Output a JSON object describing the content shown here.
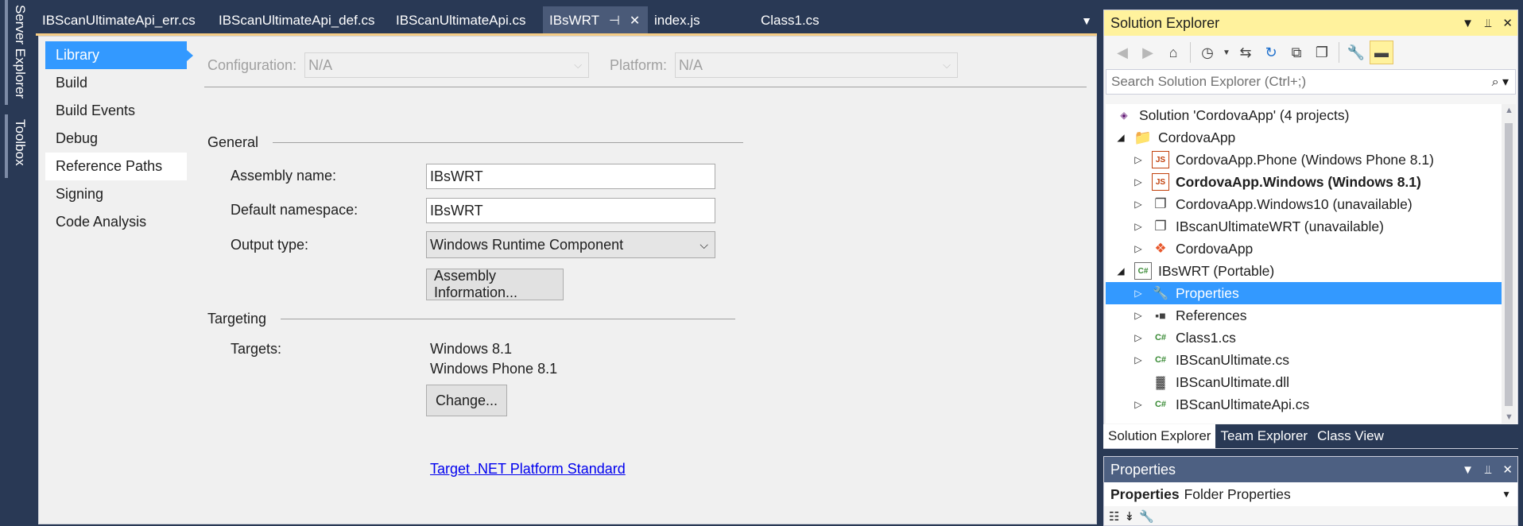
{
  "left_dock": {
    "server_explorer": "Server Explorer",
    "toolbox": "Toolbox"
  },
  "doc_tabs": [
    {
      "label": "IBScanUltimateApi_err.cs"
    },
    {
      "label": "IBScanUltimateApi_def.cs"
    },
    {
      "label": "IBScanUltimateApi.cs"
    },
    {
      "label": "IBsWRT"
    },
    {
      "label": "index.js"
    },
    {
      "label": "Class1.cs"
    }
  ],
  "prop_nav": [
    "Library",
    "Build",
    "Build Events",
    "Debug",
    "Reference Paths",
    "Signing",
    "Code Analysis"
  ],
  "config": {
    "configuration_label": "Configuration:",
    "configuration_value": "N/A",
    "platform_label": "Platform:",
    "platform_value": "N/A"
  },
  "general": {
    "header": "General",
    "assembly_name_label": "Assembly name:",
    "assembly_name_value": "IBsWRT",
    "default_namespace_label": "Default namespace:",
    "default_namespace_value": "IBsWRT",
    "output_type_label": "Output type:",
    "output_type_value": "Windows Runtime Component",
    "assembly_info_button": "Assembly Information..."
  },
  "targeting": {
    "header": "Targeting",
    "targets_label": "Targets:",
    "targets": [
      "Windows 8.1",
      "Windows Phone 8.1"
    ],
    "change_button": "Change...",
    "link": "Target .NET Platform Standard"
  },
  "solution_explorer": {
    "title": "Solution Explorer",
    "search_placeholder": "Search Solution Explorer (Ctrl+;)",
    "tree": [
      {
        "label": "Solution 'CordovaApp' (4 projects)",
        "icon": "solution-icon"
      },
      {
        "label": "CordovaApp",
        "icon": "folder-icon"
      },
      {
        "label": "CordovaApp.Phone (Windows Phone 8.1)",
        "icon": "js-project-icon"
      },
      {
        "label": "CordovaApp.Windows (Windows 8.1)",
        "icon": "js-project-icon"
      },
      {
        "label": "CordovaApp.Windows10 (unavailable)",
        "icon": "unavailable-project-icon"
      },
      {
        "label": "IBscanUltimateWRT (unavailable)",
        "icon": "unavailable-project-icon"
      },
      {
        "label": "CordovaApp",
        "icon": "cordova-icon"
      },
      {
        "label": "IBsWRT (Portable)",
        "icon": "csharp-project-icon"
      },
      {
        "label": "Properties",
        "icon": "wrench-icon"
      },
      {
        "label": "References",
        "icon": "references-icon"
      },
      {
        "label": "Class1.cs",
        "icon": "csharp-file-icon"
      },
      {
        "label": "IBScanUltimate.cs",
        "icon": "csharp-file-icon"
      },
      {
        "label": "IBScanUltimate.dll",
        "icon": "dll-icon"
      },
      {
        "label": "IBScanUltimateApi.cs",
        "icon": "csharp-file-icon"
      }
    ],
    "bottom_tabs": [
      "Solution Explorer",
      "Team Explorer",
      "Class View"
    ]
  },
  "properties_pane": {
    "title": "Properties",
    "object_name": "Properties",
    "object_type": "Folder Properties"
  },
  "colors": {
    "chrome_bg": "#293955",
    "selection": "#3399ff",
    "active_title": "#fff29d",
    "link": "#0000ee"
  }
}
